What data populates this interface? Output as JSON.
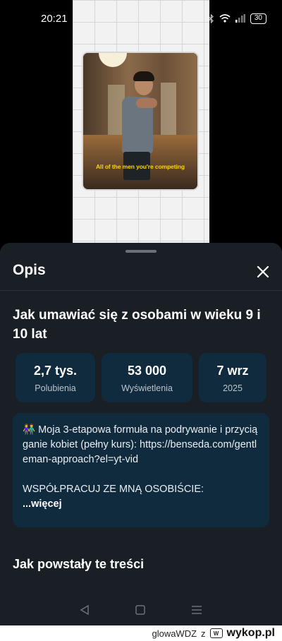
{
  "status_bar": {
    "time": "20:21",
    "battery": "30",
    "icons": [
      "cloud-icon",
      "location-icon",
      "circle-icon",
      "play-icon",
      "alarm-icon",
      "bluetooth-icon",
      "wifi-icon",
      "signal-icon",
      "battery-icon"
    ]
  },
  "video": {
    "caption": "All of the men you're competing"
  },
  "sheet": {
    "title": "Opis",
    "video_title": "Jak umawiać się z osobami w wieku 9 i 10 lat",
    "stats": [
      {
        "value": "2,7 tys.",
        "label": "Polubienia"
      },
      {
        "value": "53 000",
        "label": "Wyświetlenia"
      },
      {
        "value": "7 wrz",
        "label": "2025"
      }
    ],
    "description": {
      "line1": "👫 Moja 3-etapowa formuła na podrywanie i przyciąganie kobiet (pełny kurs): https://benseda.com/gentleman-approach?el=yt-vid",
      "line2": "WSPÓŁPRACUJ ZE MNĄ OSOBIŚCIE:",
      "more": "...więcej"
    },
    "section_title": "Jak powstały te treści"
  },
  "nav": {
    "icons": [
      "back-icon",
      "home-icon",
      "menu-icon"
    ]
  },
  "footer": {
    "username": "glowaWDZ",
    "separator": "z",
    "brand": "wykop.pl"
  },
  "colors": {
    "sheet_bg": "#1a1f25",
    "card_bg": "#102a3e",
    "caption": "#ffd400"
  }
}
